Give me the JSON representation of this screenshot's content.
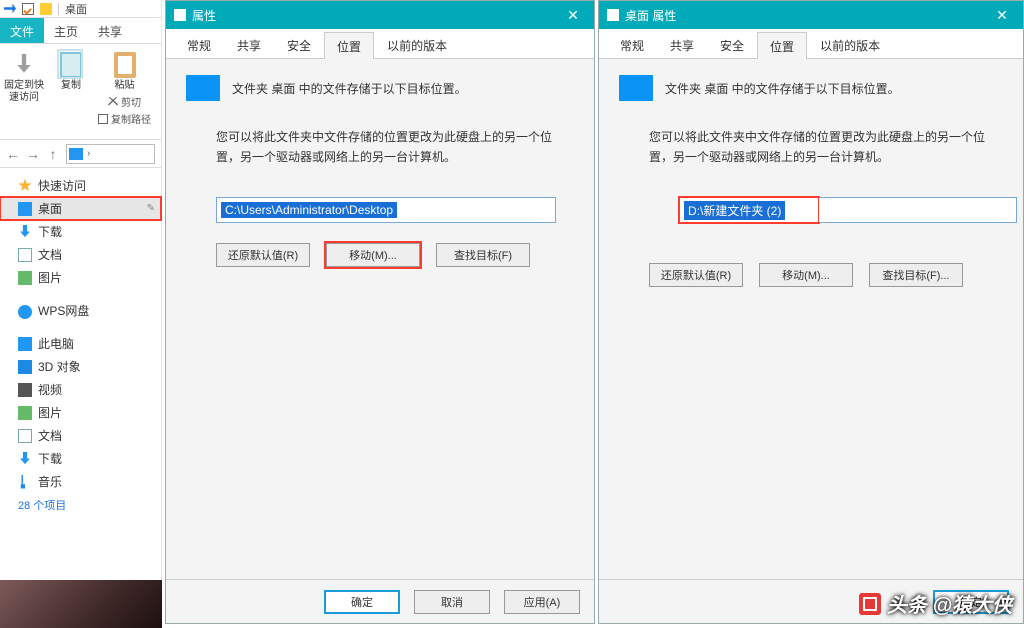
{
  "explorer": {
    "titlebar": {
      "title": "桌面"
    },
    "ribbon_tabs": {
      "file": "文件",
      "home": "主页",
      "share": "共享"
    },
    "ribbon": {
      "pin_label": "固定到快速访问",
      "copy_label": "复制",
      "paste_label": "粘贴",
      "cut_label": "剪切",
      "copypath_label": "复制路径"
    },
    "tree": {
      "quick": "快速访问",
      "desktop": "桌面",
      "downloads": "下载",
      "documents": "文档",
      "pictures": "图片",
      "wps": "WPS网盘",
      "thispc": "此电脑",
      "threed": "3D 对象",
      "videos": "视频",
      "pictures2": "图片",
      "documents2": "文档",
      "downloads2": "下载",
      "music": "音乐",
      "count": "28 个项目"
    }
  },
  "dialog1": {
    "title": "属性",
    "tabs": {
      "general": "常规",
      "share": "共享",
      "security": "安全",
      "location": "位置",
      "prev": "以前的版本"
    },
    "row1": "文件夹 桌面 中的文件存储于以下目标位置。",
    "desc": "您可以将此文件夹中文件存储的位置更改为此硬盘上的另一个位置，另一个驱动器或网络上的另一台计算机。",
    "path": "C:\\Users\\Administrator\\Desktop",
    "btn_restore": "还原默认值(R)",
    "btn_move": "移动(M)...",
    "btn_find": "查找目标(F)",
    "ok": "确定",
    "cancel": "取消",
    "apply": "应用(A)"
  },
  "dialog2": {
    "title": "桌面 属性",
    "tabs": {
      "general": "常规",
      "share": "共享",
      "security": "安全",
      "location": "位置",
      "prev": "以前的版本"
    },
    "row1": "文件夹 桌面 中的文件存储于以下目标位置。",
    "desc": "您可以将此文件夹中文件存储的位置更改为此硬盘上的另一个位置，另一个驱动器或网络上的另一台计算机。",
    "path": "D:\\新建文件夹 (2)",
    "btn_restore": "还原默认值(R)",
    "btn_move": "移动(M)...",
    "btn_find": "查找目标(F)...",
    "ok": "确定"
  },
  "watermark": "头条 @猿大侠"
}
